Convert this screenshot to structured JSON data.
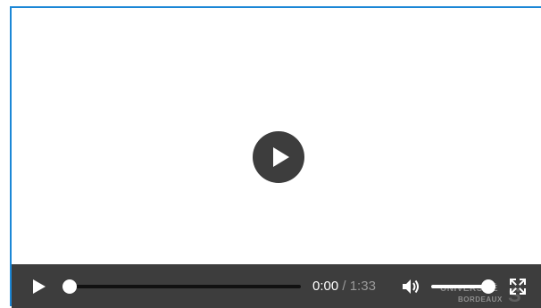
{
  "player": {
    "current_time": "0:00",
    "time_separator": "/",
    "duration": "1:33",
    "progress": 0.0,
    "volume": 1.0,
    "watermark": {
      "line1": "UNIVERSITÉ",
      "line2": "BORDEAUX",
      "mark": "S"
    },
    "icons": {
      "big_play": "play-icon",
      "play": "play-icon",
      "volume": "volume-high-icon",
      "fullscreen": "fullscreen-icon"
    },
    "colors": {
      "frame_border": "#1b87d6",
      "control_bar": "#3d3d3d",
      "track": "#111111",
      "accent": "#ffffff"
    }
  }
}
